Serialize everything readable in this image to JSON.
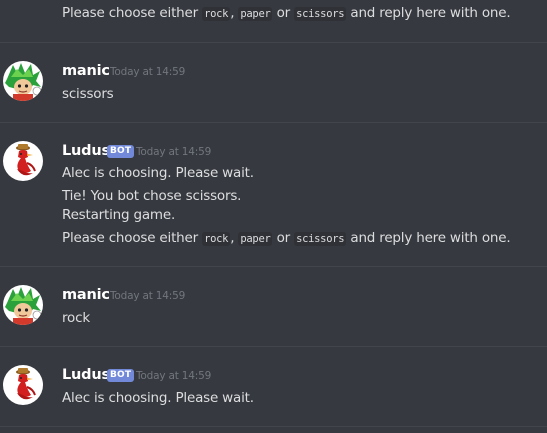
{
  "messages": {
    "top": {
      "line_pre": "Please choose either",
      "code1": "rock",
      "sep1": ",",
      "code2": "paper",
      "sep2": "or",
      "code3": "scissors",
      "line_post": "and reply here with one."
    },
    "m1": {
      "username": "manic",
      "timestamp": "Today at 14:59",
      "text": "scissors"
    },
    "m2": {
      "username": "Ludus",
      "bot_tag": "BOT",
      "timestamp": "Today at 14:59",
      "line1": "Alec is choosing. Please wait.",
      "line2": "Tie! You bot chose scissors.",
      "line3": "Restarting game.",
      "line4_pre": "Please choose either",
      "code1": "rock",
      "sep1": ",",
      "code2": "paper",
      "sep2": "or",
      "code3": "scissors",
      "line4_post": "and reply here with one."
    },
    "m3": {
      "username": "manic",
      "timestamp": "Today at 14:59",
      "text": "rock"
    },
    "m4": {
      "username": "Ludus",
      "bot_tag": "BOT",
      "timestamp": "Today at 14:59",
      "text": "Alec is choosing. Please wait."
    }
  },
  "colors": {
    "background": "#36393f",
    "divider": "#42454b",
    "username": "#ffffff",
    "text": "#dcddde",
    "timestamp": "#72767d",
    "bot_tag": "#7289da",
    "code_bg": "#2f3136"
  },
  "icons": {
    "manic_avatar": "green-spiky-hair-avatar",
    "ludus_avatar": "red-bird-avatar"
  }
}
